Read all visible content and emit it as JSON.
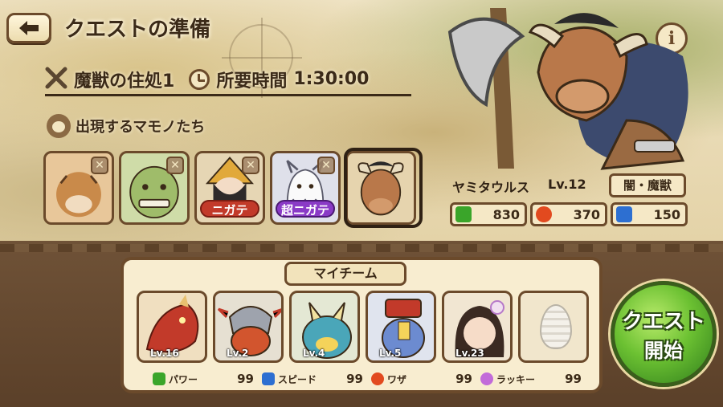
{
  "header": {
    "title": "クエストの準備"
  },
  "dungeon": {
    "name": "魔獣の住処1",
    "time_label": "所要時間",
    "time_value": "1:30:00"
  },
  "appear": {
    "label": "出現するマモノたち",
    "monsters": [
      {
        "name": "tiger-beast",
        "weak_tag": ""
      },
      {
        "name": "green-orc",
        "weak_tag": ""
      },
      {
        "name": "helmet-warrior",
        "weak_tag": "ニガテ",
        "tag_color": "#c23a2a"
      },
      {
        "name": "white-ghost",
        "weak_tag": "超ニガテ",
        "tag_color": "#8a3ac6"
      },
      {
        "name": "bull-minotaur",
        "weak_tag": ""
      }
    ]
  },
  "boss": {
    "name": "ヤミタウルス",
    "level": "Lv.12",
    "type": "闇・魔獣",
    "power": "830",
    "waza": "370",
    "speed": "150"
  },
  "team": {
    "tab": "マイチーム",
    "slots": [
      {
        "name": "red-dragon",
        "level": "Lv.16"
      },
      {
        "name": "armored-dragon",
        "level": "Lv.2"
      },
      {
        "name": "blue-horned-beast",
        "level": "Lv.4"
      },
      {
        "name": "hat-creature",
        "level": "Lv.5"
      },
      {
        "name": "shrine-girl",
        "level": "Lv.23"
      },
      {
        "name": "egg",
        "level": ""
      }
    ],
    "stats": [
      {
        "label": "パワー",
        "value": "99",
        "color": "#3aa52a"
      },
      {
        "label": "スピード",
        "value": "99",
        "color": "#2d6fd1"
      },
      {
        "label": "ワザ",
        "value": "99",
        "color": "#e24a1f"
      },
      {
        "label": "ラッキー",
        "value": "99",
        "color": "#c26bd9"
      }
    ]
  },
  "start_button": {
    "line1": "クエスト",
    "line2": "開始"
  },
  "colors": {
    "accent_green": "#6cc132",
    "frame_brown": "#6b4a2b",
    "panel_cream": "#f8edd0"
  }
}
